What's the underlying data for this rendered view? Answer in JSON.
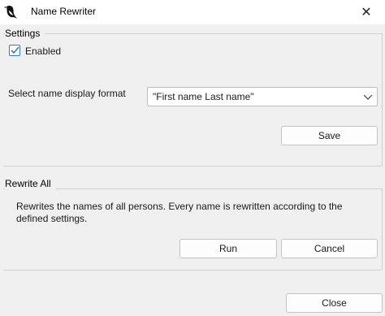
{
  "window": {
    "title": "Name Rewriter",
    "icon": "magpie-bird-icon",
    "close_glyph": "✕"
  },
  "settings": {
    "group_label": "Settings",
    "enabled_label": "Enabled",
    "enabled_checked": true,
    "format_label": "Select name display format",
    "format_value": "\"First name Last name\"",
    "save_label": "Save"
  },
  "rewrite_all": {
    "group_label": "Rewrite All",
    "description_line1": "Rewrites the names of all persons. Every name is rewritten according to the",
    "description_line2": "defined settings.",
    "run_label": "Run",
    "cancel_label": "Cancel"
  },
  "footer": {
    "close_label": "Close"
  },
  "colors": {
    "accent": "#3778c9",
    "background": "#f0f0f0",
    "titlebar": "#ffffff"
  }
}
